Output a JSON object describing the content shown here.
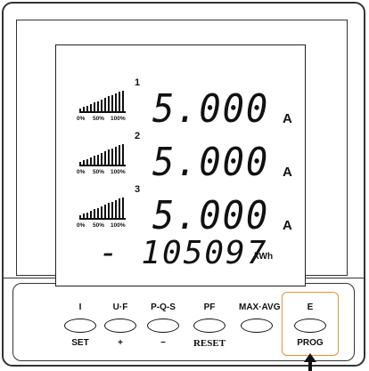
{
  "display": {
    "phases": [
      {
        "number": "1",
        "reading": "5.000",
        "unit": "A"
      },
      {
        "number": "2",
        "reading": "5.000",
        "unit": "A"
      },
      {
        "number": "3",
        "reading": "5.000",
        "unit": "A"
      }
    ],
    "bargraph_scale": {
      "min": "0%",
      "mid": "50%",
      "max": "100%"
    },
    "energy": {
      "value": "- 105097",
      "unit": "kWh"
    }
  },
  "buttons": [
    {
      "top": "I",
      "bottom": "SET"
    },
    {
      "top": "U·F",
      "bottom": "+"
    },
    {
      "top": "P-Q-S",
      "bottom": "−"
    },
    {
      "top": "PF",
      "bottom": "RESET"
    },
    {
      "top": "MAX·AVG",
      "bottom": ""
    },
    {
      "top": "E",
      "bottom": "PROG"
    }
  ],
  "highlight": {
    "target": "E / PROG",
    "color": "#e8923a"
  }
}
